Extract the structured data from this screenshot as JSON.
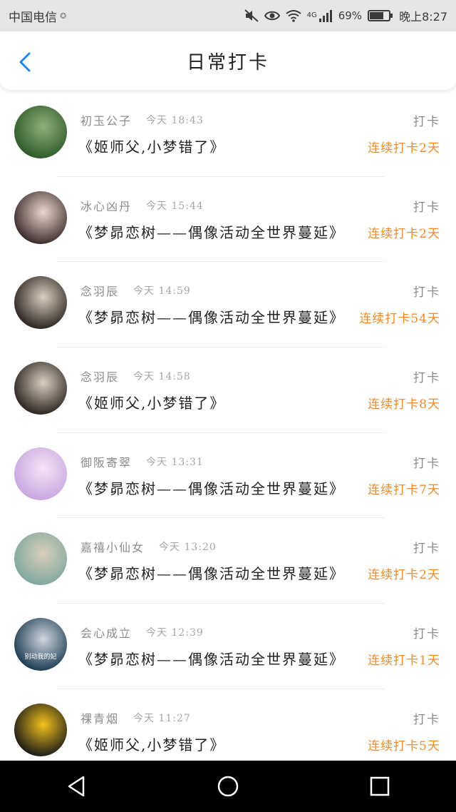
{
  "status_bar": {
    "carrier": "中国电信",
    "network": "4G",
    "battery_percent": "69%",
    "time": "晚上8:27"
  },
  "header": {
    "title": "日常打卡"
  },
  "checkins": [
    {
      "name": "初玉公子",
      "time": "今天 18:43",
      "action": "打卡",
      "task": "《姬师父,小梦错了》",
      "streak": "连续打卡2天",
      "avatar_colors": [
        "#2f5a2a",
        "#8fb07a"
      ]
    },
    {
      "name": "冰心凶丹",
      "time": "今天 15:44",
      "action": "打卡",
      "task": "《梦昴恋树——偶像活动全世界蔓延》",
      "streak": "连续打卡2天",
      "avatar_colors": [
        "#3a2c2c",
        "#f0d7d0"
      ]
    },
    {
      "name": "念羽辰",
      "time": "今天 14:59",
      "action": "打卡",
      "task": "《梦昴恋树——偶像活动全世界蔓延》",
      "streak": "连续打卡54天",
      "avatar_colors": [
        "#2a2320",
        "#d9d0bf"
      ]
    },
    {
      "name": "念羽辰",
      "time": "今天 14:58",
      "action": "打卡",
      "task": "《姬师父,小梦错了》",
      "streak": "连续打卡8天",
      "avatar_colors": [
        "#2a2320",
        "#d9d0bf"
      ]
    },
    {
      "name": "御阪寄翠",
      "time": "今天 13:31",
      "action": "打卡",
      "task": "《梦昴恋树——偶像活动全世界蔓延》",
      "streak": "连续打卡7天",
      "avatar_colors": [
        "#c8a6e0",
        "#f3e5f5"
      ]
    },
    {
      "name": "嘉禧小仙女",
      "time": "今天 13:20",
      "action": "打卡",
      "task": "《梦昴恋树——偶像活动全世界蔓延》",
      "streak": "连续打卡2天",
      "avatar_colors": [
        "#7fa7a0",
        "#d8cfb8"
      ]
    },
    {
      "name": "会心成立",
      "time": "今天 12:39",
      "action": "打卡",
      "task": "《梦昴恋树——偶像活动全世界蔓延》",
      "streak": "连续打卡1天",
      "avatar_colors": [
        "#1c3b52",
        "#cfd8df"
      ],
      "avatar_caption": "别动我的妃"
    },
    {
      "name": "祼青烟",
      "time": "今天 11:27",
      "action": "打卡",
      "task": "《姬师父,小梦错了》",
      "streak": "连续打卡5天",
      "avatar_colors": [
        "#1a1a18",
        "#f2c21c"
      ]
    }
  ],
  "colors": {
    "accent_blue": "#1e88e5",
    "streak_orange": "#f08a2a",
    "status_bar_bg": "#e6e6e6",
    "nav_bar_bg": "#000000"
  },
  "icons": {
    "back": "chevron-left-icon",
    "nav_back": "triangle-back-icon",
    "nav_home": "circle-home-icon",
    "nav_recent": "square-recent-icon"
  }
}
